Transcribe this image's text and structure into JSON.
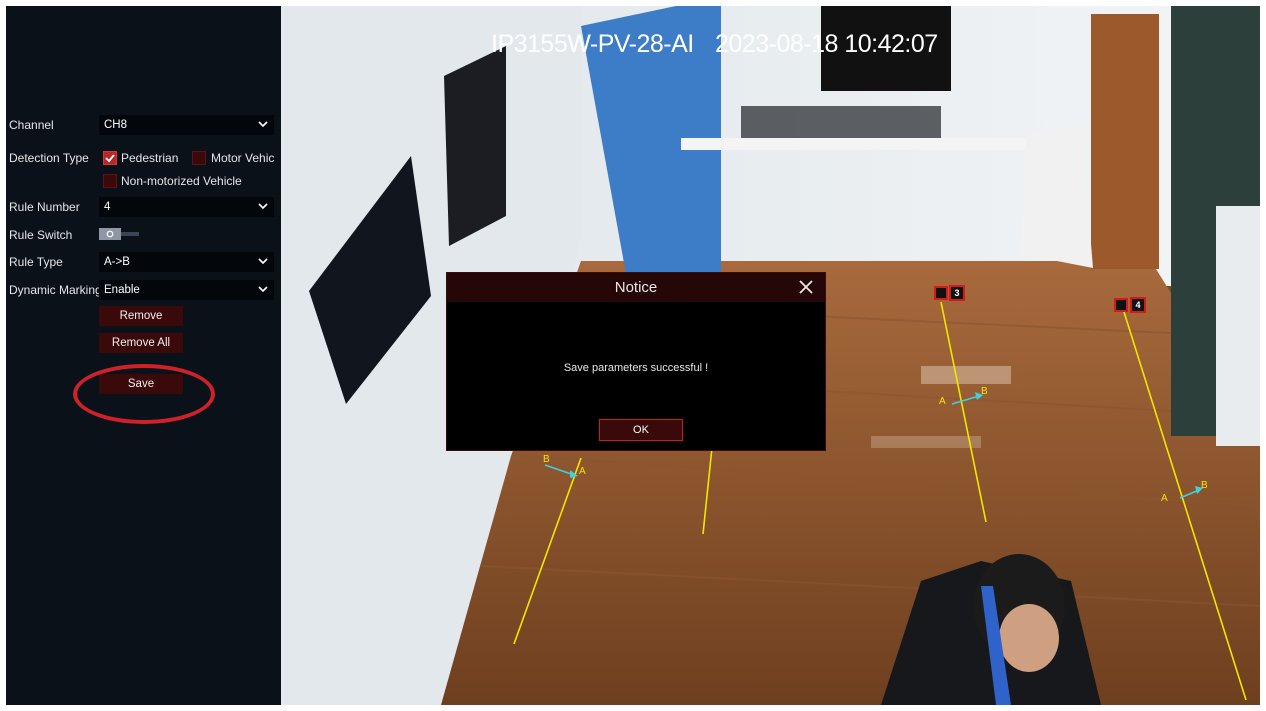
{
  "panel": {
    "channel": {
      "label": "Channel",
      "value": "CH8"
    },
    "detection_type": {
      "label": "Detection Type",
      "options": [
        {
          "label": "Pedestrian",
          "checked": true
        },
        {
          "label": "Motor Vehic",
          "checked": false
        },
        {
          "label": "Non-motorized Vehicle",
          "checked": false
        }
      ]
    },
    "rule_number": {
      "label": "Rule Number",
      "value": "4"
    },
    "rule_switch": {
      "label": "Rule Switch",
      "state": "off"
    },
    "rule_type": {
      "label": "Rule Type",
      "value": "A->B"
    },
    "dynamic_marking": {
      "label": "Dynamic Marking",
      "value": "Enable"
    },
    "buttons": {
      "remove": "Remove",
      "remove_all": "Remove All",
      "save": "Save"
    }
  },
  "video": {
    "camera_name": "IP3155W-PV-28-AI",
    "timestamp": "2023-08-18 10:42:07",
    "rule_markers": [
      "3",
      "4"
    ],
    "line_labels": [
      "A",
      "B",
      "B",
      "A",
      "A",
      "B"
    ]
  },
  "dialog": {
    "title": "Notice",
    "message": "Save parameters successful !",
    "ok_label": "OK"
  },
  "colors": {
    "accent": "#b8262a",
    "panel_bg": "#0b1119",
    "button_bg": "#3a0909",
    "rule_line": "#f2e600",
    "direction_arrow": "#3fd0e0",
    "highlight_ring": "#d0202a"
  }
}
